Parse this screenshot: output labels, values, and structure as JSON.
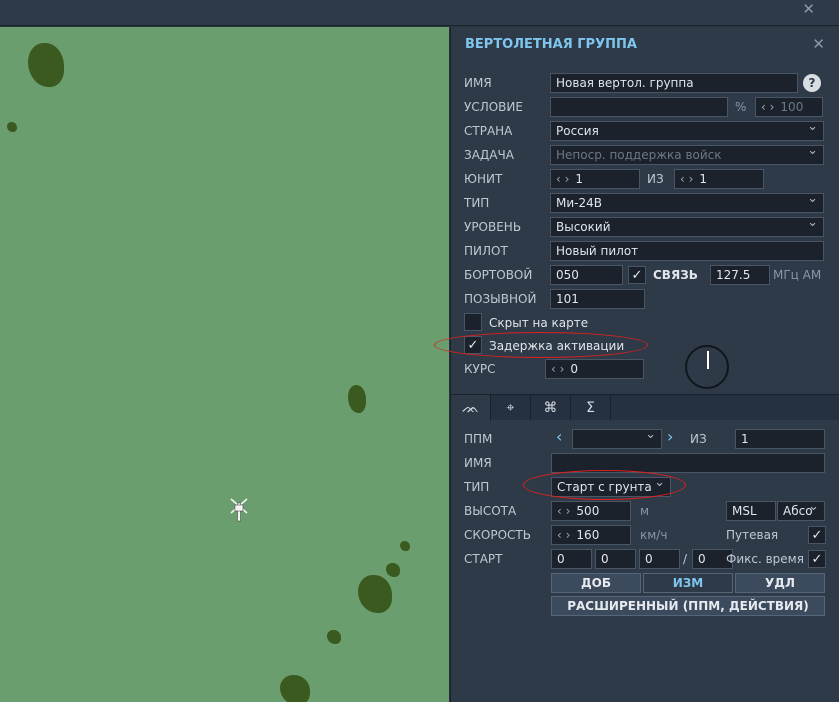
{
  "window": {
    "close_glyph": "✕"
  },
  "panel": {
    "title": "ВЕРТОЛЕТНАЯ ГРУППА",
    "close_glyph": "✕",
    "name": {
      "label": "ИМЯ",
      "value": "Новая вертол. группа",
      "help": "?"
    },
    "condition": {
      "label": "УСЛОВИЕ",
      "value": "",
      "percent": "%",
      "prob": "100"
    },
    "country": {
      "label": "СТРАНА",
      "value": "Россия"
    },
    "task": {
      "label": "ЗАДАЧА",
      "value": "Непоср. поддержка войск"
    },
    "unit": {
      "label": "ЮНИТ",
      "value": "1",
      "of_label": "ИЗ",
      "total": "1"
    },
    "type": {
      "label": "ТИП",
      "value": "Ми-24В"
    },
    "skill": {
      "label": "УРОВЕНЬ",
      "value": "Высокий"
    },
    "pilot": {
      "label": "ПИЛОТ",
      "value": "Новый пилот"
    },
    "board": {
      "label": "БОРТОВОЙ",
      "value": "050",
      "radio_label": "СВЯЗЬ",
      "freq": "127.5",
      "freq_unit": "МГц AM"
    },
    "callsign": {
      "label": "ПОЗЫВНОЙ",
      "value": "101"
    },
    "hidden": {
      "label": "Скрыт на карте",
      "checked": false
    },
    "late_activation": {
      "label": "Задержка активации",
      "checked": true
    },
    "heading": {
      "label": "КУРС",
      "value": "0"
    }
  },
  "tabs": [
    {
      "name": "route-tab",
      "icon": "route-icon",
      "glyph": "ᨏ"
    },
    {
      "name": "payload-tab",
      "icon": "target-icon",
      "glyph": "⌖"
    },
    {
      "name": "tasks-tab",
      "icon": "rotor-icon",
      "glyph": "⌘"
    },
    {
      "name": "summary-tab",
      "icon": "sigma-icon",
      "glyph": "Σ"
    }
  ],
  "waypoint": {
    "ppm_label": "ППМ",
    "ppm_value": "",
    "of_label": "ИЗ",
    "of_value": "1",
    "name_label": "ИМЯ",
    "name_value": "",
    "type_label": "ТИП",
    "type_value": "Старт с грунта",
    "alt_label": "ВЫСОТА",
    "alt_value": "500",
    "alt_unit": "м",
    "alt_ref": "MSL",
    "alt_mode": "Абсо",
    "speed_label": "СКОРОСТЬ",
    "speed_value": "160",
    "speed_unit": "км/ч",
    "route_label": "Путевая",
    "route_checked": true,
    "start_label": "СТАРТ",
    "start_h": "0",
    "start_m": "0",
    "start_s": "0",
    "start_d": "0",
    "fixed_time_label": "Фикс. время",
    "fixed_time_checked": true,
    "add_button": "ДОБ",
    "edit_button": "ИЗМ",
    "delete_button": "УДЛ",
    "advanced_button": "РАСШИРЕННЫЙ (ППМ, ДЕЙСТВИЯ)"
  },
  "glyphs": {
    "check": "✓",
    "arrows": "‹ ›"
  },
  "colors": {
    "accent": "#7fc6ef",
    "map": "#6b9e6e",
    "panel": "#2e3a48",
    "annotation": "#e0201c"
  }
}
